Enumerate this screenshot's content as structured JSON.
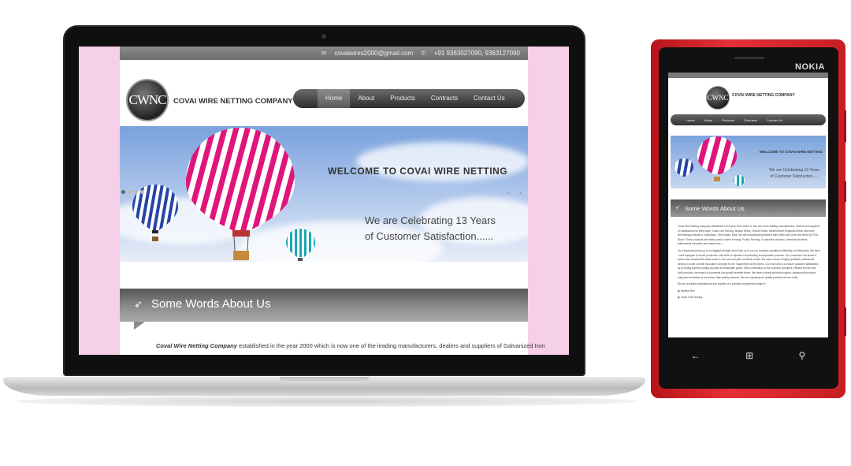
{
  "laptop_site": {
    "topbar": {
      "email_icon": "envelope-icon",
      "email": "covaiwires2000@gmail.com",
      "phone_icon": "phone-icon",
      "phones": "+91 9363027090,   9363127090"
    },
    "logo": {
      "text": "CWNC",
      "company": "COVAI WIRE NETTING COMPANY"
    },
    "nav": [
      "Home",
      "About",
      "Products",
      "Contracts",
      "Contact Us"
    ],
    "hero": {
      "welcome": "WELCOME TO COVAI WIRE NETTING",
      "sub1": "We are Celebrating 13 Years",
      "sub2": "of Customer Satisfaction......"
    },
    "slider": {
      "prev": "‹",
      "next": "›"
    },
    "words": {
      "icon": "rocket-icon",
      "title": "Some Words About Us"
    },
    "intro": {
      "company": "Coval Wire Netting Company",
      "text": " established in the year 2000 which is now one of the leading manufacturers, dealers and suppliers of Galvanized Iron"
    }
  },
  "phone": {
    "brand": "NOKIA",
    "hero_welcome": "WELCOME TO COVAI WIRE NETTING",
    "hero_sub1": "We are Celebrating 13 Years",
    "hero_sub2": "of Customer Satisfaction......",
    "nav": [
      "Home",
      "About",
      "Products",
      "Contracts",
      "Contact Us"
    ],
    "words_title": "Some Words About Us",
    "paragraphs": [
      "Covai Wire Netting Company  established in the year 2000 which is now one of the leading manufacturers, dealers and suppliers of Galvanized Iron Wire Mesh, Chain Link Fencing, Barbed Wires, Chicken Mesh, Welded Mesh Expanded Mesh and other wirenetting products in Coimbatore, Tamil Nadu, India. We are manufacturing Barbed Wire Mesh and Chain link Mesh by TATA Brand. These products are widely used in Home Fencing, Poultry Fencing, Construction industry, chemical industries, automobiles industries and many more.....",
      "Our infrastructural set up is our biggest strength which help us to run our business operations efficiently and effectively. We have a well equipped in-house production unit which is capable of culminating incomparable products. Our production unit boast of world class machineries which work on low cost and yield excellent results. We have a team of highly qualified professional striving to come out with innovative concepts for the requirement of the clients. Our main aim is to ensure customer satisfaction by providing superior quality products at reasonable prices. With combination of fair business principles, efficient service and solid products, we expect a successful and growth oriented future. We have a strong technical support, advanced production equipment enabling us to produce high quality products. We are supplying our quality products all over India.",
      "We are a leading manufacturer and supplier of a precision engineered range of :-"
    ],
    "list": [
      "Barbed Wire",
      "Chain Link Fencing"
    ]
  }
}
